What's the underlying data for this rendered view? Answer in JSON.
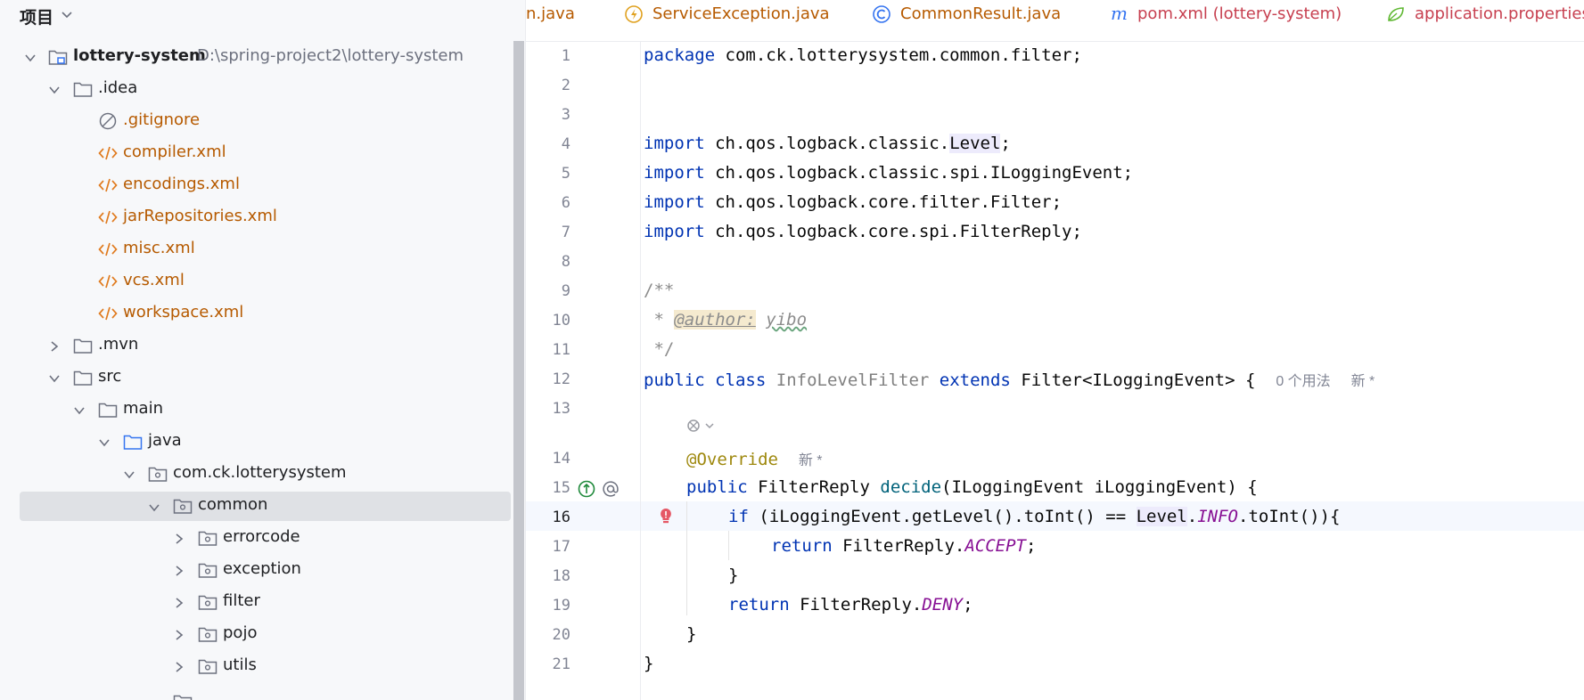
{
  "project_panel": {
    "title": "项目",
    "tree": [
      {
        "label": "lottery-system",
        "path": "D:\\spring-project2\\lottery-system",
        "expanded": true
      },
      {
        "label": ".idea",
        "expanded": true
      },
      {
        "label": ".gitignore"
      },
      {
        "label": "compiler.xml"
      },
      {
        "label": "encodings.xml"
      },
      {
        "label": "jarRepositories.xml"
      },
      {
        "label": "misc.xml"
      },
      {
        "label": "vcs.xml"
      },
      {
        "label": "workspace.xml"
      },
      {
        "label": ".mvn",
        "expanded": false
      },
      {
        "label": "src",
        "expanded": true
      },
      {
        "label": "main",
        "expanded": true
      },
      {
        "label": "java",
        "expanded": true
      },
      {
        "label": "com.ck.lotterysystem",
        "expanded": true
      },
      {
        "label": "common",
        "expanded": true,
        "selected": true
      },
      {
        "label": "errorcode",
        "expanded": false
      },
      {
        "label": "exception",
        "expanded": false
      },
      {
        "label": "filter",
        "expanded": false
      },
      {
        "label": "pojo",
        "expanded": false
      },
      {
        "label": "utils",
        "expanded": false
      }
    ]
  },
  "tabs": [
    {
      "label": "n.java",
      "color": "#b65a00"
    },
    {
      "label": "ServiceException.java",
      "color": "#b65a00",
      "icon": "exception-class-icon"
    },
    {
      "label": "CommonResult.java",
      "color": "#b65a00",
      "icon": "class-icon"
    },
    {
      "label": "pom.xml (lottery-system)",
      "color": "#c74050",
      "icon": "maven-icon"
    },
    {
      "label": "application.properties",
      "color": "#c74050",
      "icon": "spring-properties-icon"
    }
  ],
  "editor": {
    "line_numbers": [
      "1",
      "2",
      "3",
      "4",
      "5",
      "6",
      "7",
      "8",
      "9",
      "10",
      "11",
      "12",
      "13",
      "14",
      "15",
      "16",
      "17",
      "18",
      "19",
      "20",
      "21"
    ],
    "current_line": "16",
    "code": {
      "l1": {
        "kw": "package",
        "rest": " com.ck.lotterysystem.common.filter;"
      },
      "l4": {
        "kw": "import",
        "a": " ch.qos.logback.classic.",
        "b": "Level",
        "c": ";"
      },
      "l5": {
        "kw": "import",
        "rest": " ch.qos.logback.classic.spi.ILoggingEvent;"
      },
      "l6": {
        "kw": "import",
        "rest": " ch.qos.logback.core.filter.Filter;"
      },
      "l7": {
        "kw": "import",
        "rest": " ch.qos.logback.core.spi.FilterReply;"
      },
      "l9": {
        "text": "/**"
      },
      "l10": {
        "star": " * ",
        "tag": "@author:",
        "sp": " ",
        "name": "yibo"
      },
      "l11": {
        "text": " */"
      },
      "l12": {
        "kw1": "public",
        "kw2": "class",
        "cls": "InfoLevelFilter",
        "kw3": "extends",
        "rest": "Filter<ILoggingEvent> {",
        "inlay1": "0 个用法",
        "inlay2": "新 *"
      },
      "l14": {
        "ann": "@Override",
        "inlay": "新 *"
      },
      "l15": {
        "kw": "public",
        "type": "FilterReply",
        "fn": "decide",
        "rest": "(ILoggingEvent iLoggingEvent) {"
      },
      "l16": {
        "kw": "if",
        "a": " (iLoggingEvent.getLevel().toInt() == ",
        "b": "Level",
        "c": ".",
        "d": "INFO",
        "e": ".toInt()){"
      },
      "l17": {
        "kw": "return",
        "a": " FilterReply.",
        "b": "ACCEPT",
        "c": ";"
      },
      "l18": {
        "text": "}"
      },
      "l19": {
        "kw": "return",
        "a": " FilterReply.",
        "b": "DENY",
        "c": ";"
      },
      "l20": {
        "text": "}"
      },
      "l21": {
        "text": "}"
      }
    }
  }
}
